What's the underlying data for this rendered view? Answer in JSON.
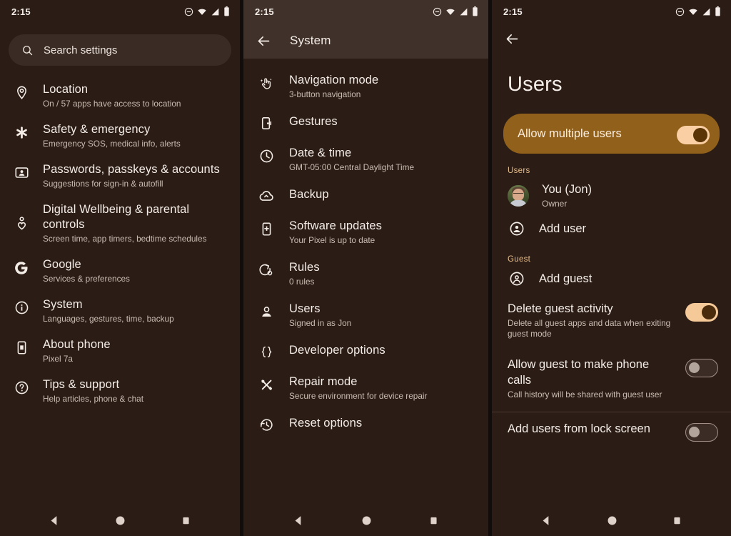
{
  "status_bar": {
    "time": "2:15",
    "icons": [
      "dnd-icon",
      "wifi-icon",
      "signal-icon",
      "battery-icon"
    ]
  },
  "colors": {
    "background": "#2b1d16",
    "appbar": "#40322a",
    "accent_card": "#91601a",
    "switch_on": "#f6c999",
    "section_label": "#e7bd8b",
    "primary_text": "#f4ece7",
    "secondary_text": "#cbbcb2"
  },
  "panel_settings": {
    "search": {
      "placeholder": "Search settings",
      "icon": "search-icon"
    },
    "items": [
      {
        "icon": "location-pin-icon",
        "title": "Location",
        "subtitle": "On / 57 apps have access to location"
      },
      {
        "icon": "asterisk-icon",
        "title": "Safety & emergency",
        "subtitle": "Emergency SOS, medical info, alerts"
      },
      {
        "icon": "passkey-id-icon",
        "title": "Passwords, passkeys & accounts",
        "subtitle": "Suggestions for sign-in & autofill"
      },
      {
        "icon": "wellbeing-icon",
        "title": "Digital Wellbeing & parental controls",
        "subtitle": "Screen time, app timers, bedtime schedules"
      },
      {
        "icon": "google-g-icon",
        "title": "Google",
        "subtitle": "Services & preferences"
      },
      {
        "icon": "info-circle-icon",
        "title": "System",
        "subtitle": "Languages, gestures, time, backup"
      },
      {
        "icon": "phone-device-icon",
        "title": "About phone",
        "subtitle": "Pixel 7a"
      },
      {
        "icon": "help-circle-icon",
        "title": "Tips & support",
        "subtitle": "Help articles, phone & chat"
      }
    ]
  },
  "panel_system": {
    "appbar": {
      "back_icon": "back-arrow-icon",
      "title": "System"
    },
    "items": [
      {
        "icon": "navigation-gesture-icon",
        "title": "Navigation mode",
        "subtitle": "3-button navigation"
      },
      {
        "icon": "gestures-icon",
        "title": "Gestures",
        "subtitle": ""
      },
      {
        "icon": "clock-icon",
        "title": "Date & time",
        "subtitle": "GMT-05:00 Central Daylight Time"
      },
      {
        "icon": "cloud-upload-icon",
        "title": "Backup",
        "subtitle": ""
      },
      {
        "icon": "software-update-icon",
        "title": "Software updates",
        "subtitle": "Your Pixel is up to date"
      },
      {
        "icon": "rules-icon",
        "title": "Rules",
        "subtitle": "0 rules"
      },
      {
        "icon": "person-icon",
        "title": "Users",
        "subtitle": "Signed in as Jon"
      },
      {
        "icon": "braces-icon",
        "title": "Developer options",
        "subtitle": ""
      },
      {
        "icon": "repair-tools-icon",
        "title": "Repair mode",
        "subtitle": "Secure environment for device repair"
      },
      {
        "icon": "history-reset-icon",
        "title": "Reset options",
        "subtitle": ""
      }
    ]
  },
  "panel_users": {
    "back_icon": "back-arrow-icon",
    "title": "Users",
    "hero_toggle": {
      "label": "Allow multiple users",
      "state": "on"
    },
    "users_section_label": "Users",
    "users": [
      {
        "avatar": "user-photo-avatar",
        "name": "You (Jon)",
        "role": "Owner"
      }
    ],
    "add_user": {
      "icon": "add-person-circle-icon",
      "label": "Add user"
    },
    "guest_section_label": "Guest",
    "add_guest": {
      "icon": "add-guest-circle-icon",
      "label": "Add guest"
    },
    "guest_toggles": [
      {
        "title": "Delete guest activity",
        "subtitle": "Delete all guest apps and data when exiting guest mode",
        "state": "on"
      },
      {
        "title": "Allow guest to make phone calls",
        "subtitle": "Call history will be shared with guest user",
        "state": "off"
      }
    ],
    "lock_screen_toggle": {
      "title": "Add users from lock screen",
      "subtitle": "",
      "state": "off"
    }
  },
  "nav_bar": {
    "back": "nav-back-icon",
    "home": "nav-home-icon",
    "recents": "nav-recents-icon"
  }
}
